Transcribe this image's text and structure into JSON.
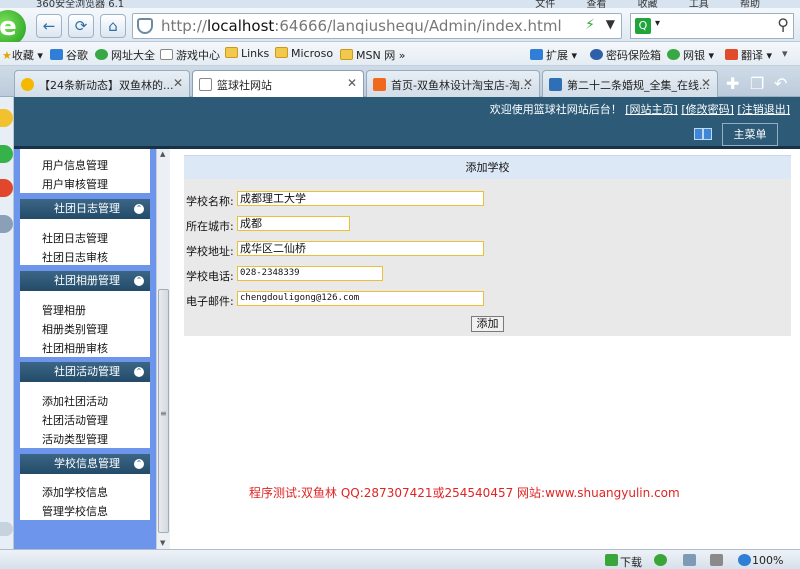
{
  "browser": {
    "title": "360安全浏览器 6.1",
    "menus": [
      "文件",
      "查看",
      "收藏",
      "工具",
      "帮助"
    ],
    "url_prefix": "http://",
    "url_host": "localhost",
    "url_rest": ":64666/lanqiushequ/Admin/index.html",
    "search_placeholder": "",
    "favorites": [
      {
        "label": "收藏",
        "icon": "star-icon"
      },
      {
        "label": "谷歌",
        "icon": "google-icon"
      },
      {
        "label": "网址大全",
        "icon": "site-nav-icon"
      },
      {
        "label": "游戏中心",
        "icon": "page-icon"
      },
      {
        "label": "Links",
        "icon": "folder-icon"
      },
      {
        "label": "Microso",
        "icon": "folder-icon"
      },
      {
        "label": "MSN 网",
        "icon": "folder-icon"
      }
    ],
    "toolbar_right": [
      {
        "label": "扩展",
        "icon": "extension-icon"
      },
      {
        "label": "密码保险箱",
        "icon": "key-icon"
      },
      {
        "label": "网银",
        "icon": "bank-icon"
      },
      {
        "label": "翻译",
        "icon": "translate-icon"
      }
    ],
    "tabs": [
      {
        "label": "【24条新动态】双鱼林的...",
        "active": false
      },
      {
        "label": "篮球社网站",
        "active": true
      },
      {
        "label": "首页-双鱼林设计淘宝店-淘...",
        "active": false
      },
      {
        "label": "第二十二条婚规_全集_在线...",
        "active": false
      }
    ],
    "status": {
      "download": "下载",
      "zoom": "100%"
    }
  },
  "header": {
    "welcome": "欢迎使用篮球社网站后台！",
    "links": [
      "[网站主页]",
      "[修改密码]",
      "[注销退出]"
    ],
    "menu_button": "主菜单"
  },
  "menu": {
    "groups": [
      {
        "title": "",
        "items": [
          "用户信息管理",
          "用户审核管理"
        ]
      },
      {
        "title": "社团日志管理",
        "items": [
          "社团日志管理",
          "社团日志审核"
        ]
      },
      {
        "title": "社团相册管理",
        "items": [
          "管理相册",
          "相册类别管理",
          "社团相册审核"
        ]
      },
      {
        "title": "社团活动管理",
        "items": [
          "添加社团活动",
          "社团活动管理",
          "活动类型管理"
        ]
      },
      {
        "title": "学校信息管理",
        "items": [
          "添加学校信息",
          "管理学校信息"
        ]
      }
    ]
  },
  "form": {
    "title": "添加学校",
    "fields": [
      {
        "label": "学校名称:",
        "value": "成都理工大学"
      },
      {
        "label": "所在城市:",
        "value": "成都"
      },
      {
        "label": "学校地址:",
        "value": "成华区二仙桥"
      },
      {
        "label": "学校电话:",
        "value": "028-2348339"
      },
      {
        "label": "电子邮件:",
        "value": "chengdouligong@126.com"
      }
    ],
    "submit": "添加"
  },
  "credit": "程序测试:双鱼林 QQ:287307421或254540457 网站:www.shuangyulin.com"
}
